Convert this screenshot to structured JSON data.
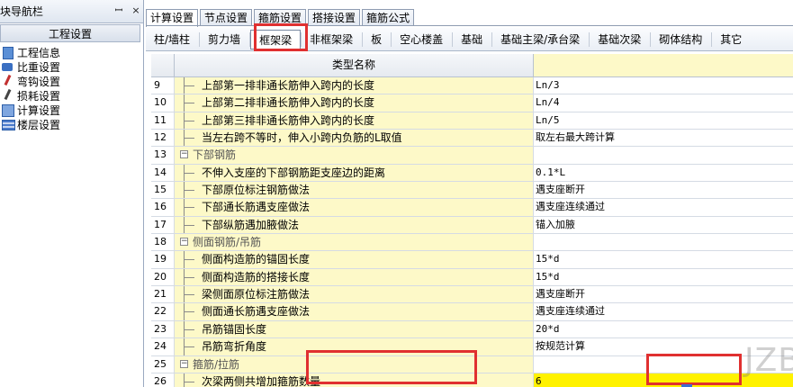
{
  "left_panel": {
    "title": "模块导航栏",
    "title_visible": "块导航栏",
    "pin_icon": "pin-icon",
    "close_icon": "close-icon",
    "section": "工程设置",
    "items": [
      {
        "label": "工程信息",
        "icon": "info-icon"
      },
      {
        "label": "比重设置",
        "icon": "weight-icon"
      },
      {
        "label": "弯钩设置",
        "icon": "hook-icon"
      },
      {
        "label": "损耗设置",
        "icon": "loss-icon"
      },
      {
        "label": "计算设置",
        "icon": "calc-icon"
      },
      {
        "label": "楼层设置",
        "icon": "floor-icon"
      }
    ]
  },
  "top_tabs": [
    "计算设置",
    "节点设置",
    "箍筋设置",
    "搭接设置",
    "箍筋公式"
  ],
  "active_top_tab": "计算设置",
  "sub_tabs": [
    "柱/墙柱",
    "剪力墙",
    "框架梁",
    "非框架梁",
    "板",
    "空心楼盖",
    "基础",
    "基础主梁/承台梁",
    "基础次梁",
    "砌体结构",
    "其它"
  ],
  "active_sub_tab": "框架梁",
  "grid": {
    "header_name": "类型名称",
    "rows": [
      {
        "num": "9",
        "name": "上部第一排非通长筋伸入跨内的长度",
        "value": "Ln/3",
        "type": "item"
      },
      {
        "num": "10",
        "name": "上部第二排非通长筋伸入跨内的长度",
        "value": "Ln/4",
        "type": "item"
      },
      {
        "num": "11",
        "name": "上部第三排非通长筋伸入跨内的长度",
        "value": "Ln/5",
        "type": "item"
      },
      {
        "num": "12",
        "name": "当左右跨不等时，伸入小跨内负筋的L取值",
        "value": "取左右最大跨计算",
        "type": "item"
      },
      {
        "num": "13",
        "name": "下部钢筋",
        "value": "",
        "type": "group"
      },
      {
        "num": "14",
        "name": "不伸入支座的下部钢筋距支座边的距离",
        "value": "0.1*L",
        "type": "item"
      },
      {
        "num": "15",
        "name": "下部原位标注钢筋做法",
        "value": "遇支座断开",
        "type": "item"
      },
      {
        "num": "16",
        "name": "下部通长筋遇支座做法",
        "value": "遇支座连续通过",
        "type": "item"
      },
      {
        "num": "17",
        "name": "下部纵筋遇加腋做法",
        "value": "锚入加腋",
        "type": "item"
      },
      {
        "num": "18",
        "name": "侧面钢筋/吊筋",
        "value": "",
        "type": "group"
      },
      {
        "num": "19",
        "name": "侧面构造筋的锚固长度",
        "value": "15*d",
        "type": "item"
      },
      {
        "num": "20",
        "name": "侧面构造筋的搭接长度",
        "value": "15*d",
        "type": "item"
      },
      {
        "num": "21",
        "name": "梁侧面原位标注筋做法",
        "value": "遇支座断开",
        "type": "item"
      },
      {
        "num": "22",
        "name": "侧面通长筋遇支座做法",
        "value": "遇支座连续通过",
        "type": "item"
      },
      {
        "num": "23",
        "name": "吊筋锚固长度",
        "value": "20*d",
        "type": "item"
      },
      {
        "num": "24",
        "name": "吊筋弯折角度",
        "value": "按规范计算",
        "type": "item"
      },
      {
        "num": "25",
        "name": "箍筋/拉筋",
        "value": "",
        "type": "group"
      },
      {
        "num": "26",
        "name": "次梁两侧共增加箍筋数量",
        "value": "6",
        "type": "item",
        "highlight": true
      }
    ]
  },
  "watermark": "JZBAR.NET",
  "colors": {
    "name_cell_bg": "#fdf9c8",
    "highlight": "#fff200",
    "annotation_red": "#e03030"
  }
}
